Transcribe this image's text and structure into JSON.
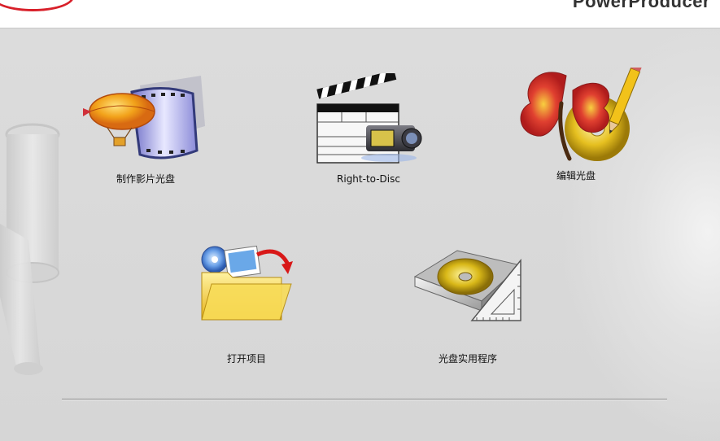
{
  "header": {
    "brand": "PowerProducer"
  },
  "tiles": [
    {
      "label": "制作影片光盘",
      "icon": "film-balloon-icon"
    },
    {
      "label": "Right-to-Disc",
      "icon": "clapperboard-camcorder-icon"
    },
    {
      "label": "编辑光盘",
      "icon": "butterfly-disc-pencil-icon"
    },
    {
      "label": "打开项目",
      "icon": "open-folder-icon"
    },
    {
      "label": "光盘实用程序",
      "icon": "disc-tray-ruler-icon"
    }
  ],
  "colors": {
    "background": "#d9d9d9",
    "brand_red": "#d8202a"
  }
}
